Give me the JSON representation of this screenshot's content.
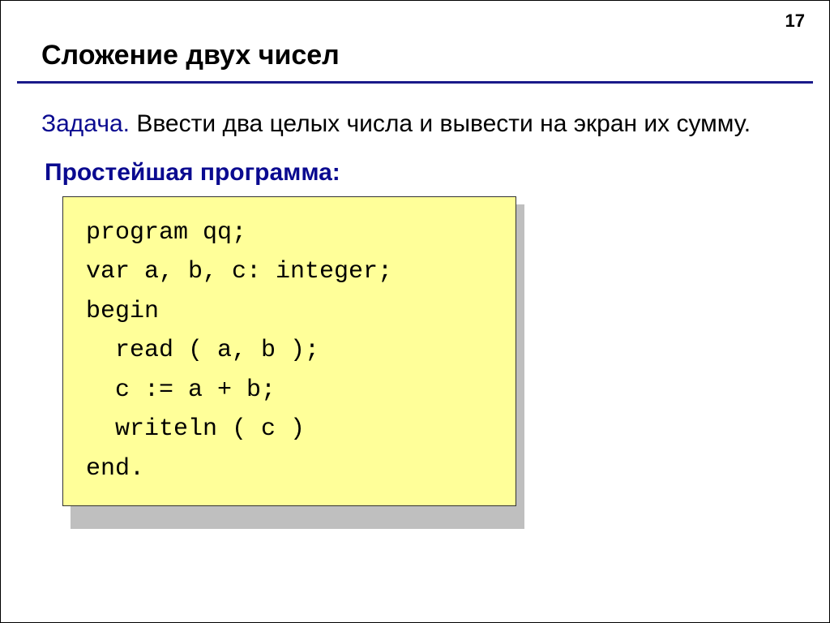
{
  "page_number": "17",
  "title": "Сложение двух чисел",
  "task": {
    "label": "Задача.",
    "text": " Ввести два целых числа и вывести на экран их сумму."
  },
  "subheading": "Простейшая программа:",
  "code": {
    "lines": [
      "program qq;",
      "var a, b, c: integer;",
      "begin",
      "  read ( a, b );",
      "  c := a + b;",
      "  writeln ( c )",
      "end."
    ]
  }
}
